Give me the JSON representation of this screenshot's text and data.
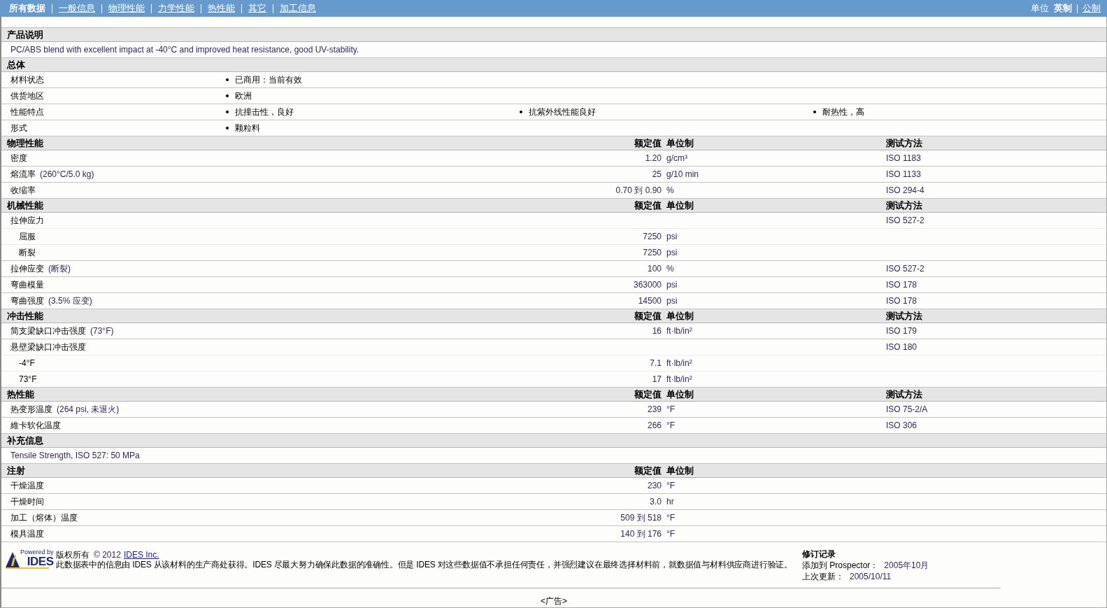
{
  "nav": {
    "tabs": [
      {
        "label": "所有数据",
        "selected": true
      },
      {
        "label": "一般信息",
        "selected": false
      },
      {
        "label": "物理性能",
        "selected": false
      },
      {
        "label": "力学性能",
        "selected": false
      },
      {
        "label": "热性能",
        "selected": false
      },
      {
        "label": "其它",
        "selected": false
      },
      {
        "label": "加工信息",
        "selected": false
      }
    ]
  },
  "units": {
    "label": "单位",
    "options": [
      {
        "label": "英制",
        "selected": true
      },
      {
        "label": "公制",
        "selected": false
      }
    ]
  },
  "sections": [
    {
      "kind": "text",
      "title": "产品说明",
      "text": "PC/ABS blend with excellent impact at -40°C and improved heat resistance, good UV-stability."
    },
    {
      "kind": "list",
      "title": "总体",
      "rows": [
        {
          "label": "材料状态",
          "values": [
            "已商用：当前有效"
          ]
        },
        {
          "label": "供货地区",
          "values": [
            "欧洲"
          ]
        },
        {
          "label": "性能特点",
          "values": [
            "抗撞击性，良好",
            "抗紫外线性能良好",
            "耐热性，高"
          ]
        },
        {
          "label": "形式",
          "values": [
            "颗粒料"
          ]
        }
      ]
    },
    {
      "kind": "table",
      "title": "物理性能",
      "headers": [
        "额定值",
        "单位制",
        "测试方法"
      ],
      "rows": [
        {
          "label": "密度",
          "value": "1.20",
          "unit": "g/cm³",
          "method": "ISO 1183"
        },
        {
          "label": "熔流率",
          "condition": "(260°C/5.0 kg)",
          "value": "25",
          "unit": "g/10 min",
          "method": "ISO 1133"
        },
        {
          "label": "收缩率",
          "value": "0.70 到 0.90",
          "unit": "%",
          "method": "ISO 294-4"
        }
      ]
    },
    {
      "kind": "table",
      "title": "机械性能",
      "headers": [
        "额定值",
        "单位制",
        "测试方法"
      ],
      "rows": [
        {
          "label": "拉伸应力",
          "method": "ISO 527-2",
          "children": [
            {
              "label": "屈服",
              "value": "7250",
              "unit": "psi"
            },
            {
              "label": "断裂",
              "value": "7250",
              "unit": "psi"
            }
          ]
        },
        {
          "label": "拉伸应变",
          "condition": "(断裂)",
          "value": "100",
          "unit": "%",
          "method": "ISO 527-2"
        },
        {
          "label": "弯曲模量",
          "value": "363000",
          "unit": "psi",
          "method": "ISO 178"
        },
        {
          "label": "弯曲强度",
          "condition": "(3.5% 应变)",
          "value": "14500",
          "unit": "psi",
          "method": "ISO 178"
        }
      ]
    },
    {
      "kind": "table",
      "title": "冲击性能",
      "headers": [
        "额定值",
        "单位制",
        "测试方法"
      ],
      "rows": [
        {
          "label": "简支梁缺口冲击强度",
          "condition": "(73°F)",
          "value": "16",
          "unit": "ft·lb/in²",
          "method": "ISO 179"
        },
        {
          "label": "悬壁梁缺口冲击强度",
          "method": "ISO 180",
          "children": [
            {
              "label": "-4°F",
              "value": "7.1",
              "unit": "ft·lb/in²"
            },
            {
              "label": "73°F",
              "value": "17",
              "unit": "ft·lb/in²"
            }
          ]
        }
      ]
    },
    {
      "kind": "table",
      "title": "热性能",
      "headers": [
        "额定值",
        "单位制",
        "测试方法"
      ],
      "rows": [
        {
          "label": "热变形温度",
          "condition": "(264 psi, 未退火)",
          "value": "239",
          "unit": "°F",
          "method": "ISO 75-2/A"
        },
        {
          "label": "維卡软化温度",
          "value": "266",
          "unit": "°F",
          "method": "ISO 306"
        }
      ]
    },
    {
      "kind": "text",
      "title": "补充信息",
      "text": "Tensile Strength, ISO 527: 50 MPa"
    },
    {
      "kind": "table",
      "title": "注射",
      "headers": [
        "额定值",
        "单位制"
      ],
      "rows": [
        {
          "label": "干燥温度",
          "value": "230",
          "unit": "°F"
        },
        {
          "label": "干燥时间",
          "value": "3.0",
          "unit": "hr"
        },
        {
          "label": "加工（熔体）温度",
          "value": "509 到 518",
          "unit": "°F"
        },
        {
          "label": "模具温度",
          "value": "140 到 176",
          "unit": "°F"
        }
      ]
    }
  ],
  "footer": {
    "logo": {
      "tagline": "Powered by",
      "name": "IDES"
    },
    "copyright": {
      "label": "版权所有",
      "year": "© 2012",
      "link": "IDES Inc."
    },
    "disclaimer": "此数据表中的信息由 IDES 从该材料的生产商处获得。IDES 尽最大努力确保此数据的准确性。但是 IDES 对这些数据值不承担任何责任，并强烈建议在最终选择材料前，就数据值与材料供应商进行验证。",
    "revision": {
      "title": "修订记录",
      "rows": [
        {
          "label": "添加到 Prospector：",
          "value": "2005年10月"
        },
        {
          "label": "上次更新：",
          "value": "2005/10/11"
        }
      ]
    }
  },
  "ad": "<广告>"
}
